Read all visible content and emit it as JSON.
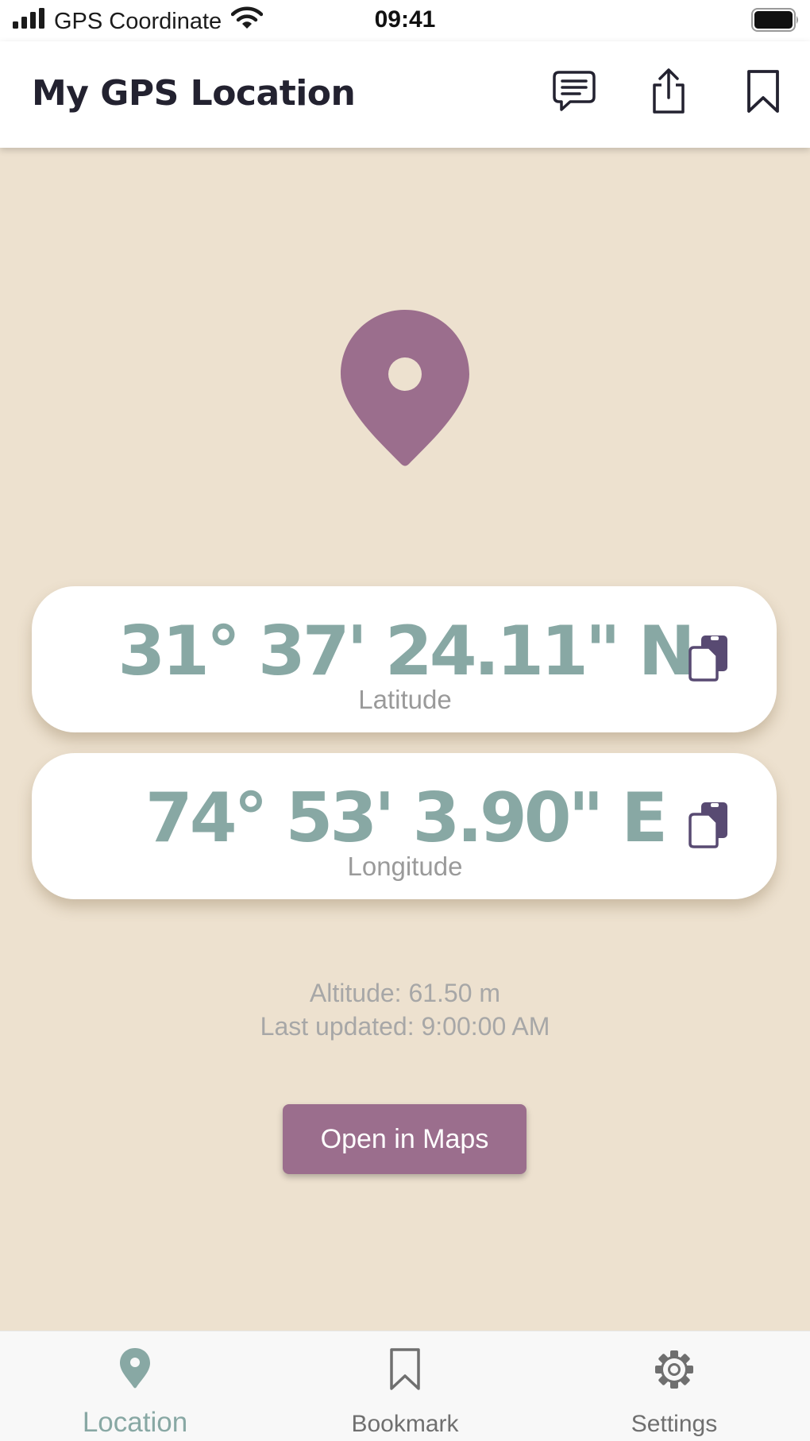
{
  "status_bar": {
    "carrier": "GPS Coordinate",
    "time": "09:41"
  },
  "app_bar": {
    "title": "My GPS Location",
    "actions": [
      "message-icon",
      "share-icon",
      "bookmark-icon"
    ]
  },
  "location": {
    "latitude": {
      "value": "31° 37' 24.11\" N",
      "label": "Latitude"
    },
    "longitude": {
      "value": "74° 53' 3.90\" E",
      "label": "Longitude"
    },
    "altitude": "Altitude: 61.50 m",
    "last_updated": "Last updated: 9:00:00 AM",
    "open_maps_label": "Open in Maps"
  },
  "tab_bar": {
    "tabs": [
      {
        "label": "Location",
        "icon": "location-pin-icon",
        "active": true
      },
      {
        "label": "Bookmark",
        "icon": "bookmark-icon",
        "active": false
      },
      {
        "label": "Settings",
        "icon": "gear-icon",
        "active": false
      }
    ]
  },
  "colors": {
    "background": "#ede1cf",
    "accent_purple": "#9b6e8d",
    "accent_teal": "#88a8a4",
    "copy_icon": "#584a72",
    "title_text": "#232230"
  }
}
